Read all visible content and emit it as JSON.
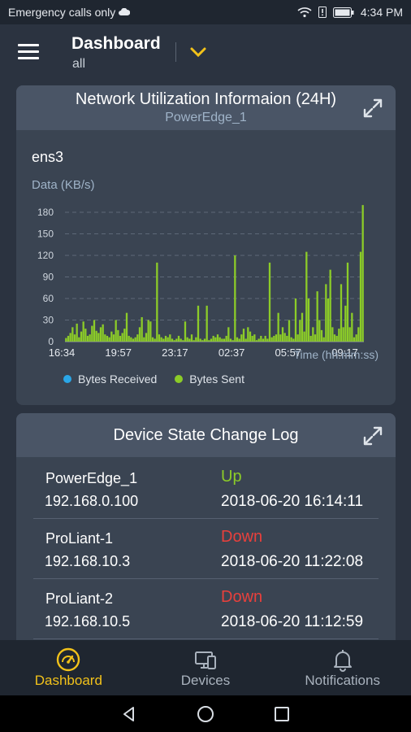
{
  "status_bar": {
    "carrier": "Emergency calls only",
    "time": "4:34 PM"
  },
  "header": {
    "title": "Dashboard",
    "subtitle": "all"
  },
  "network_card": {
    "title": "Network Utilization Informaion (24H)",
    "device": "PowerEdge_1",
    "interface": "ens3",
    "y_axis_label": "Data (KB/s)",
    "x_axis_label": "Time (hh:mm:ss)",
    "legend": [
      {
        "label": "Bytes Received",
        "color": "#2aa7e8"
      },
      {
        "label": "Bytes Sent",
        "color": "#8ccc28"
      }
    ]
  },
  "chart_data": {
    "type": "bar",
    "ylim": [
      0,
      180
    ],
    "y_ticks": [
      0,
      30,
      60,
      90,
      120,
      150,
      180
    ],
    "x_tick_labels": [
      "16:34",
      "19:57",
      "23:17",
      "02:37",
      "05:57",
      "09:17"
    ],
    "xlabel": "Time (hh:mm:ss)",
    "ylabel": "Data (KB/s)",
    "grid": "horizontal dashed",
    "legend_placement": "bottom",
    "series": [
      {
        "name": "Bytes Received",
        "color": "#2aa7e8",
        "values": []
      },
      {
        "name": "Bytes Sent",
        "color": "#8ccc28",
        "values": [
          5,
          8,
          12,
          20,
          10,
          25,
          6,
          14,
          28,
          18,
          8,
          10,
          22,
          30,
          15,
          12,
          20,
          24,
          10,
          8,
          6,
          14,
          10,
          30,
          16,
          8,
          12,
          18,
          40,
          8,
          6,
          4,
          6,
          10,
          20,
          34,
          6,
          12,
          30,
          28,
          6,
          4,
          110,
          10,
          6,
          4,
          8,
          6,
          10,
          4,
          2,
          4,
          8,
          4,
          2,
          28,
          6,
          4,
          10,
          2,
          6,
          50,
          4,
          2,
          4,
          50,
          2,
          4,
          8,
          6,
          10,
          6,
          4,
          4,
          8,
          20,
          4,
          2,
          120,
          6,
          4,
          10,
          18,
          4,
          20,
          14,
          8,
          10,
          2,
          4,
          8,
          4,
          8,
          4,
          110,
          6,
          8,
          10,
          40,
          10,
          20,
          12,
          8,
          30,
          6,
          4,
          60,
          10,
          30,
          40,
          14,
          125,
          60,
          8,
          20,
          10,
          70,
          30,
          16,
          6,
          80,
          60,
          100,
          20,
          10,
          8,
          18,
          80,
          20,
          50,
          110,
          20,
          40,
          6,
          10,
          20,
          125,
          190
        ]
      }
    ]
  },
  "log_card": {
    "title": "Device State Change Log",
    "rows": [
      {
        "name": "PowerEdge_1",
        "ip": "192.168.0.100",
        "state": "Up",
        "state_color": "#8ccc28",
        "time": "2018-06-20 16:14:11"
      },
      {
        "name": "ProLiant-1",
        "ip": "192.168.10.3",
        "state": "Down",
        "state_color": "#e8403c",
        "time": "2018-06-20 11:22:08"
      },
      {
        "name": "ProLiant-2",
        "ip": "192.168.10.5",
        "state": "Down",
        "state_color": "#e8403c",
        "time": "2018-06-20 11:12:59"
      }
    ]
  },
  "tabs": [
    {
      "label": "Dashboard",
      "active": true,
      "icon": "gauge-icon"
    },
    {
      "label": "Devices",
      "active": false,
      "icon": "devices-icon"
    },
    {
      "label": "Notifications",
      "active": false,
      "icon": "bell-icon"
    }
  ],
  "colors": {
    "accent": "#f2c21a",
    "background": "#2b3340",
    "card": "#3a4452",
    "card_header": "#4a5566"
  }
}
